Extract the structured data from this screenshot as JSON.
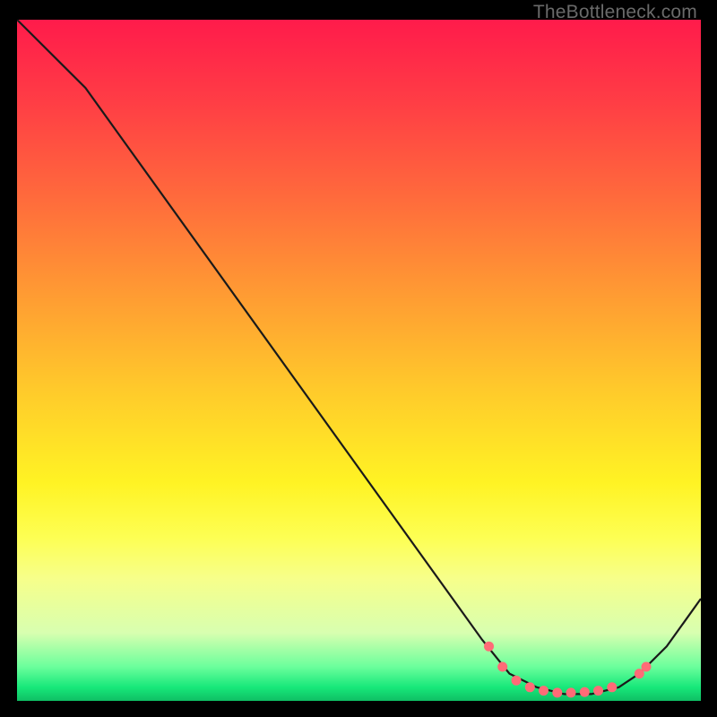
{
  "attribution": "TheBottleneck.com",
  "colors": {
    "page_bg": "#000000",
    "gradient_top": "#ff1b4b",
    "gradient_bottom": "#0fbf64",
    "curve": "#1a1a1a",
    "marker": "#ff6b77",
    "attribution_text": "#6a6a6a"
  },
  "chart_data": {
    "type": "line",
    "title": "",
    "xlabel": "",
    "ylabel": "",
    "xlim": [
      0,
      100
    ],
    "ylim": [
      0,
      100
    ],
    "series": [
      {
        "name": "curve",
        "points": [
          {
            "x": 0,
            "y": 100
          },
          {
            "x": 7,
            "y": 93
          },
          {
            "x": 10,
            "y": 90
          },
          {
            "x": 68,
            "y": 9
          },
          {
            "x": 72,
            "y": 4
          },
          {
            "x": 76,
            "y": 2
          },
          {
            "x": 80,
            "y": 1
          },
          {
            "x": 84,
            "y": 1
          },
          {
            "x": 88,
            "y": 2
          },
          {
            "x": 91,
            "y": 4
          },
          {
            "x": 95,
            "y": 8
          },
          {
            "x": 100,
            "y": 15
          }
        ]
      }
    ],
    "markers": [
      {
        "x": 69,
        "y": 8
      },
      {
        "x": 71,
        "y": 5
      },
      {
        "x": 73,
        "y": 3
      },
      {
        "x": 75,
        "y": 2
      },
      {
        "x": 77,
        "y": 1.5
      },
      {
        "x": 79,
        "y": 1.2
      },
      {
        "x": 81,
        "y": 1.2
      },
      {
        "x": 83,
        "y": 1.3
      },
      {
        "x": 85,
        "y": 1.5
      },
      {
        "x": 87,
        "y": 2
      },
      {
        "x": 91,
        "y": 4
      },
      {
        "x": 92,
        "y": 5
      }
    ]
  }
}
